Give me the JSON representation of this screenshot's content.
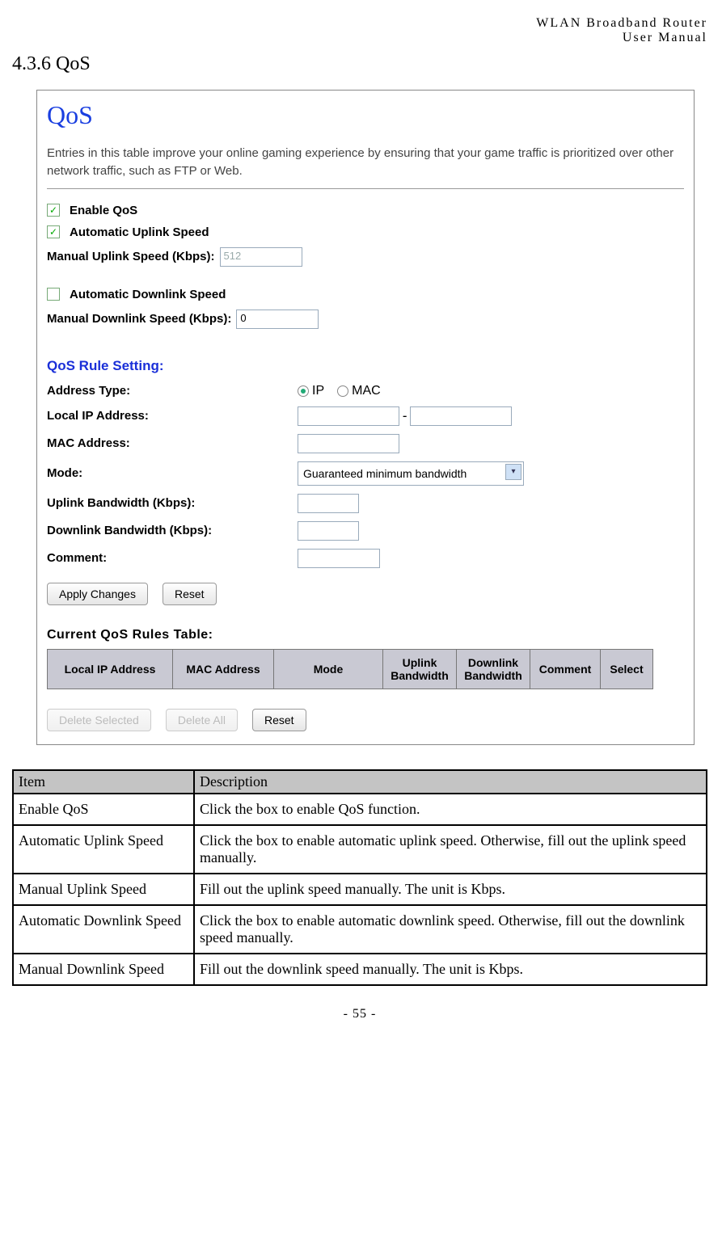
{
  "doc_header_line1": "WLAN  Broadband  Router",
  "doc_header_line2": "User  Manual",
  "section_heading": "4.3.6  QoS",
  "shot": {
    "title": "QoS",
    "description": "Entries in this table improve your online gaming experience by ensuring that your game traffic is prioritized over other network traffic, such as FTP or Web.",
    "enable_qos_label": "Enable QoS",
    "auto_uplink_label": "Automatic Uplink Speed",
    "manual_uplink_label": "Manual Uplink Speed (Kbps):",
    "manual_uplink_value": "512",
    "auto_downlink_label": "Automatic Downlink Speed",
    "manual_downlink_label": "Manual Downlink Speed (Kbps):",
    "manual_downlink_value": "0",
    "rule_section": "QoS Rule Setting:",
    "address_type_label": "Address Type:",
    "radio_ip": "IP",
    "radio_mac": "MAC",
    "local_ip_label": "Local IP Address:",
    "ip_range_sep": "-",
    "mac_label": "MAC Address:",
    "mode_label": "Mode:",
    "mode_selected": "Guaranteed minimum bandwidth",
    "uplink_bw_label": "Uplink Bandwidth (Kbps):",
    "downlink_bw_label": "Downlink Bandwidth (Kbps):",
    "comment_label": "Comment:",
    "apply_btn": "Apply Changes",
    "reset_btn": "Reset",
    "current_table_title": "Current QoS Rules Table:",
    "table_headers": [
      "Local IP Address",
      "MAC Address",
      "Mode",
      "Uplink Bandwidth",
      "Downlink Bandwidth",
      "Comment",
      "Select"
    ],
    "delete_sel_btn": "Delete Selected",
    "delete_all_btn": "Delete All",
    "reset2_btn": "Reset"
  },
  "desc_table": {
    "header_item": "Item",
    "header_desc": "Description",
    "rows": [
      {
        "item": "Enable QoS",
        "desc": "Click the box to enable QoS function."
      },
      {
        "item": "Automatic Uplink Speed",
        "desc": "Click the box to enable automatic uplink speed. Otherwise, fill out the uplink speed manually."
      },
      {
        "item": "Manual Uplink Speed",
        "desc": "Fill out the uplink speed manually. The unit is Kbps."
      },
      {
        "item": "Automatic Downlink Speed",
        "desc": "Click the box to enable automatic downlink speed. Otherwise, fill out the downlink speed manually."
      },
      {
        "item": "Manual Downlink Speed",
        "desc": "Fill out the downlink speed manually. The unit is Kbps."
      }
    ]
  },
  "page_footer": "- 55 -"
}
